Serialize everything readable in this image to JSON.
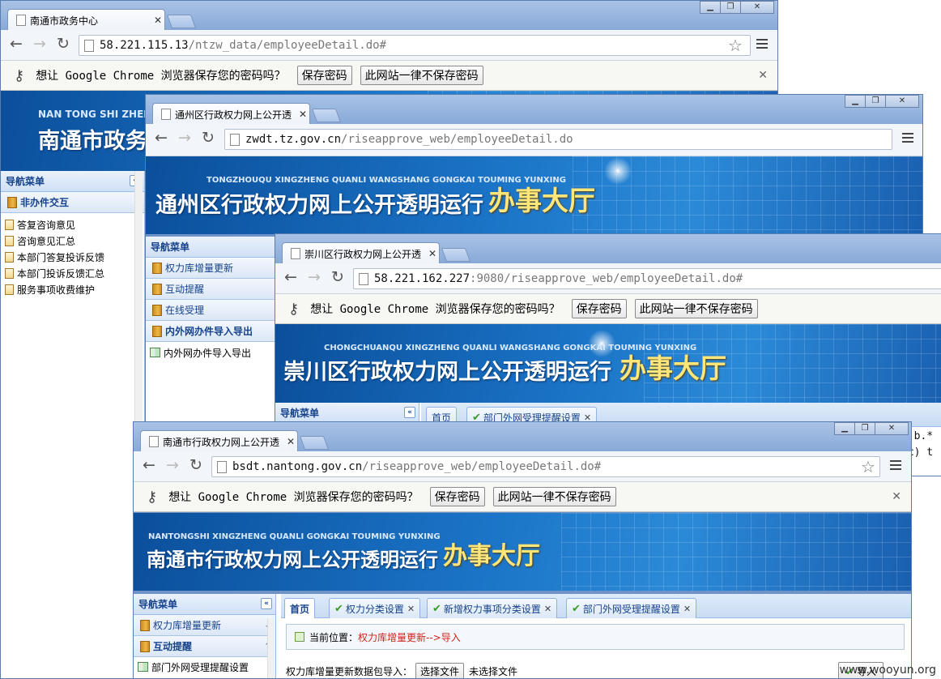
{
  "windows": {
    "w1": {
      "tab_title": "南通市政务中心",
      "url_host": "58.221.115.13",
      "url_path": "/ntzw_data/employeeDetail.do#",
      "infobar": {
        "message": "想让 Google Chrome 浏览器保存您的密码吗？",
        "save": "保存密码",
        "never": "此网站一律不保存密码"
      },
      "banner": {
        "pinyin": "NAN TONG SHI ZHENG W",
        "title": "南通市政务"
      },
      "sidebar": {
        "header": "导航菜单",
        "section": "非办件交互",
        "items": [
          "答复咨询意见",
          "咨询意见汇总",
          "本部门答复投诉反馈",
          "本部门投诉反馈汇总",
          "服务事项收费维护"
        ]
      }
    },
    "w2": {
      "tab_title": "通州区行政权力网上公开透",
      "url_host": "zwdt.tz.gov.cn",
      "url_path": "/riseapprove_web/employeeDetail.do",
      "banner": {
        "pinyin": "TONGZHOUQU XINGZHENG QUANLI WANGSHANG GONGKAI TOUMING YUNXING",
        "title": "通州区行政权力网上公开透明运行",
        "hall": "办事大厅"
      },
      "sidebar": {
        "header": "导航菜单",
        "sections": [
          "权力库增量更新",
          "互动提醒",
          "在线受理",
          "内外网办件导入导出"
        ],
        "leaf": "内外网办件导入导出"
      }
    },
    "w3": {
      "tab_title": "崇川区行政权力网上公开透",
      "url_host": "58.221.162.227",
      "url_port": ":9080",
      "url_path": "/riseapprove_web/employeeDetail.do#",
      "infobar": {
        "message": "想让 Google Chrome 浏览器保存您的密码吗？",
        "save": "保存密码",
        "never": "此网站一律不保存密码"
      },
      "banner": {
        "pinyin": "CHONGCHUANQU XINGZHENG QUANLI WANGSHANG GONGKAI TOUMING YUNXING",
        "title": "崇川区行政权力网上公开透明运行",
        "hall": "办事大厅"
      },
      "sidebar": {
        "header": "导航菜单"
      },
      "tabs": [
        "首页",
        "部门外网受理提醒设置"
      ],
      "code_lines": [
        "t b.*",
        "sc) t"
      ]
    },
    "w4": {
      "tab_title": "南通市行政权力网上公开透",
      "url_host": "bsdt.nantong.gov.cn",
      "url_path": "/riseapprove_web/employeeDetail.do#",
      "infobar": {
        "message": "想让 Google Chrome 浏览器保存您的密码吗？",
        "save": "保存密码",
        "never": "此网站一律不保存密码"
      },
      "banner": {
        "pinyin": "NANTONGSHI XINGZHENG QUANLI GONGKAI TOUMING YUNXING",
        "title": "南通市行政权力网上公开透明运行",
        "hall": "办事大厅"
      },
      "sidebar": {
        "header": "导航菜单",
        "sections": [
          "权力库增量更新",
          "互动提醒"
        ],
        "leaf": "部门外网受理提醒设置"
      },
      "tabs": [
        "首页",
        "权力分类设置",
        "新增权力事项分类设置",
        "部门外网受理提醒设置"
      ],
      "location": {
        "label": "当前位置：",
        "path": "权力库增量更新-->导入"
      },
      "upload": {
        "label": "权力库增量更新数据包导入：",
        "choose": "选择文件",
        "status": "未选择文件",
        "import": "导入"
      }
    }
  },
  "watermark": "www.wooyun.org",
  "colors": {
    "banner_blue": "#1b74c7",
    "hall_yellow": "#ffe67a",
    "path_red": "#d0231a",
    "nav_blue": "#15428b"
  }
}
